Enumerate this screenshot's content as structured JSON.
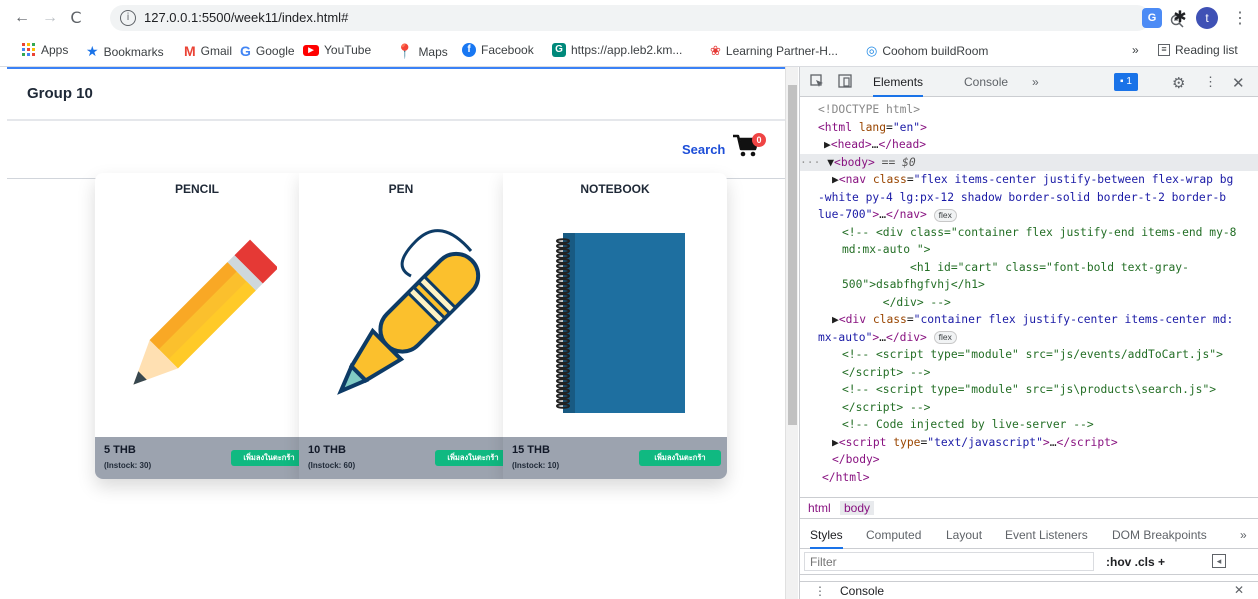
{
  "browser": {
    "url": "127.0.0.1:5500/week11/index.html#",
    "nav": {
      "back": "←",
      "forward": "→",
      "reload": "C"
    },
    "profile_initial": "t",
    "bookmarks": [
      {
        "label": "Apps",
        "icon": "apps-grid-icon",
        "color": "#ea4335"
      },
      {
        "label": "Bookmarks",
        "icon": "star-icon",
        "color": "#1a73e8"
      },
      {
        "label": "Gmail",
        "icon": "gmail-icon",
        "color": "#ea4335"
      },
      {
        "label": "Google",
        "icon": "google-icon",
        "color": "#4285f4"
      },
      {
        "label": "YouTube",
        "icon": "youtube-icon",
        "color": "#ff0000"
      },
      {
        "label": "Maps",
        "icon": "maps-icon",
        "color": "#34a853"
      },
      {
        "label": "Facebook",
        "icon": "facebook-icon",
        "color": "#1877f2"
      },
      {
        "label": "https://app.leb2.km...",
        "icon": "leb2-icon",
        "color": "#00897b"
      },
      {
        "label": "Learning Partner-H...",
        "icon": "huawei-icon",
        "color": "#e53935"
      },
      {
        "label": "Coohom buildRoom",
        "icon": "coohom-icon",
        "color": "#1e88e5"
      }
    ],
    "bookmarks_overflow": "»",
    "reading_list": "Reading list"
  },
  "app": {
    "brand": "Group 10",
    "search_label": "Search",
    "cart_count": "0",
    "add_label": "เพิ่มลงในตะกร้า",
    "products": [
      {
        "name": "PENCIL",
        "price": "5 THB",
        "stock": "(Instock: 30)",
        "image": "pencil-icon"
      },
      {
        "name": "PEN",
        "price": "10 THB",
        "stock": "(Instock: 60)",
        "image": "pen-icon"
      },
      {
        "name": "NOTEBOOK",
        "price": "15 THB",
        "stock": "(Instock: 10)",
        "image": "notebook-icon"
      }
    ]
  },
  "devtools": {
    "tabs": {
      "elements": "Elements",
      "console": "Console",
      "more": "»"
    },
    "issues_count": "1",
    "breadcrumbs": [
      "html",
      "body"
    ],
    "styles_tabs": [
      "Styles",
      "Computed",
      "Layout",
      "Event Listeners",
      "DOM Breakpoints",
      "»"
    ],
    "filter_placeholder": "Filter",
    "filter_tools": ":hov .cls +",
    "drawer_label": "Console"
  },
  "colors": {
    "accent_blue": "#3b82f6",
    "add_green": "#10b981",
    "footer_gray": "#9ca3af",
    "link_blue": "#1d4ed8"
  }
}
